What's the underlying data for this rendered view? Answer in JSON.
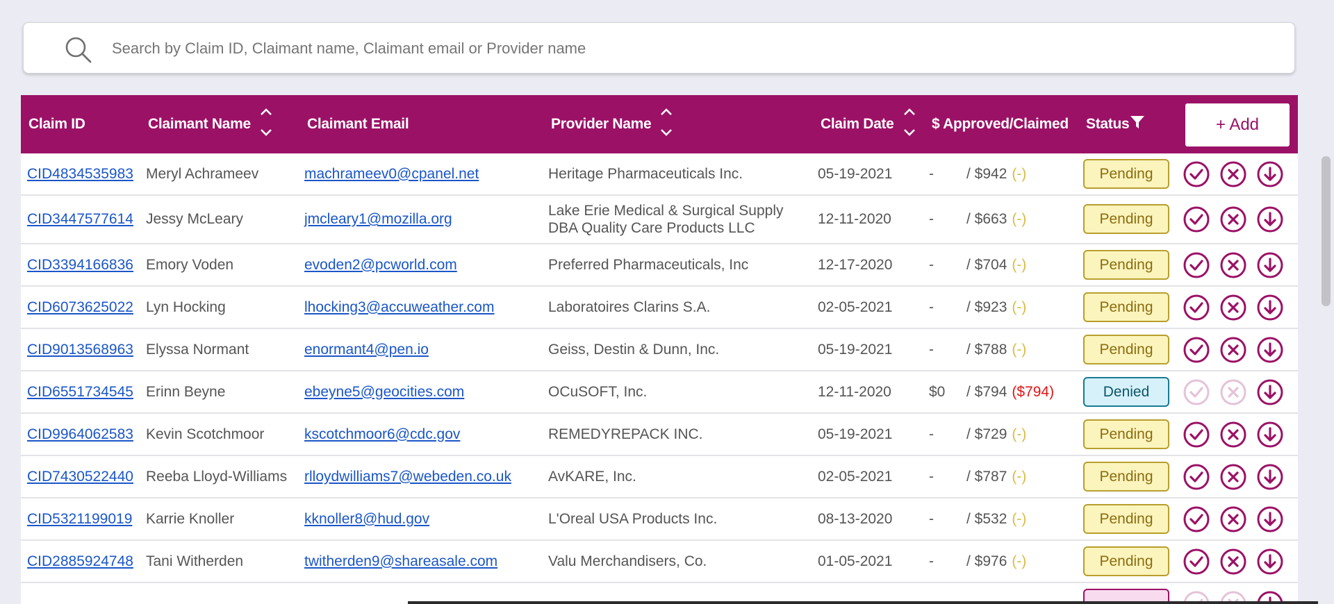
{
  "search": {
    "placeholder": "Search by Claim ID, Claimant name, Claimant email or Provider name",
    "value": ""
  },
  "table": {
    "headers": {
      "claim_id": "Claim ID",
      "claimant_name": "Claimant Name",
      "claimant_email": "Claimant Email",
      "provider_name": "Provider Name",
      "claim_date": "Claim Date",
      "amount": "$ Approved/Claimed",
      "status": "Status"
    },
    "add_label": "+ Add",
    "rows": [
      {
        "id": "CID4834535983",
        "name": "Meryl Achrameev",
        "email": "machrameev0@cpanel.net",
        "provider": "Heritage Pharmaceuticals Inc.",
        "date": "05-19-2021",
        "approved": "-",
        "claimed": "/ $942",
        "diff": "(-)",
        "status": "Pending"
      },
      {
        "id": "CID3447577614",
        "name": "Jessy McLeary",
        "email": "jmcleary1@mozilla.org",
        "provider": "Lake Erie Medical & Surgical Supply DBA Quality Care Products LLC",
        "date": "12-11-2020",
        "approved": "-",
        "claimed": "/ $663",
        "diff": "(-)",
        "status": "Pending"
      },
      {
        "id": "CID3394166836",
        "name": "Emory Voden",
        "email": "evoden2@pcworld.com",
        "provider": "Preferred Pharmaceuticals, Inc",
        "date": "12-17-2020",
        "approved": "-",
        "claimed": "/ $704",
        "diff": "(-)",
        "status": "Pending"
      },
      {
        "id": "CID6073625022",
        "name": "Lyn Hocking",
        "email": "lhocking3@accuweather.com",
        "provider": "Laboratoires Clarins S.A.",
        "date": "02-05-2021",
        "approved": "-",
        "claimed": "/ $923",
        "diff": "(-)",
        "status": "Pending"
      },
      {
        "id": "CID9013568963",
        "name": "Elyssa Normant",
        "email": "enormant4@pen.io",
        "provider": "Geiss, Destin & Dunn, Inc.",
        "date": "05-19-2021",
        "approved": "-",
        "claimed": "/ $788",
        "diff": "(-)",
        "status": "Pending"
      },
      {
        "id": "CID6551734545",
        "name": "Erinn Beyne",
        "email": "ebeyne5@geocities.com",
        "provider": "OCuSOFT, Inc.",
        "date": "12-11-2020",
        "approved": "$0",
        "claimed": "/ $794",
        "diff": "($794)",
        "status": "Denied"
      },
      {
        "id": "CID9964062583",
        "name": "Kevin Scotchmoor",
        "email": "kscotchmoor6@cdc.gov",
        "provider": "REMEDYREPACK INC.",
        "date": "05-19-2021",
        "approved": "-",
        "claimed": "/ $729",
        "diff": "(-)",
        "status": "Pending"
      },
      {
        "id": "CID7430522440",
        "name": "Reeba Lloyd-Williams",
        "email": "rlloydwilliams7@webeden.co.uk",
        "provider": "AvKARE, Inc.",
        "date": "02-05-2021",
        "approved": "-",
        "claimed": "/ $787",
        "diff": "(-)",
        "status": "Pending"
      },
      {
        "id": "CID5321199019",
        "name": "Karrie Knoller",
        "email": "kknoller8@hud.gov",
        "provider": "L'Oreal USA Products Inc.",
        "date": "08-13-2020",
        "approved": "-",
        "claimed": "/ $532",
        "diff": "(-)",
        "status": "Pending"
      },
      {
        "id": "CID2885924748",
        "name": "Tani Witherden",
        "email": "twitherden9@shareasale.com",
        "provider": "Valu Merchandisers, Co.",
        "date": "01-05-2021",
        "approved": "-",
        "claimed": "/ $976",
        "diff": "(-)",
        "status": "Pending"
      }
    ]
  },
  "colors": {
    "header_bg": "#9b1166",
    "link": "#1a56c8",
    "pending_bg": "#fcf4bd",
    "denied_bg": "#d7f1fa",
    "negative": "#e01515"
  },
  "icons": {
    "search": "search-icon",
    "sort": "sort-icon",
    "filter": "filter-icon",
    "approve": "check-circle-icon",
    "reject": "x-circle-icon",
    "download": "download-circle-icon"
  }
}
